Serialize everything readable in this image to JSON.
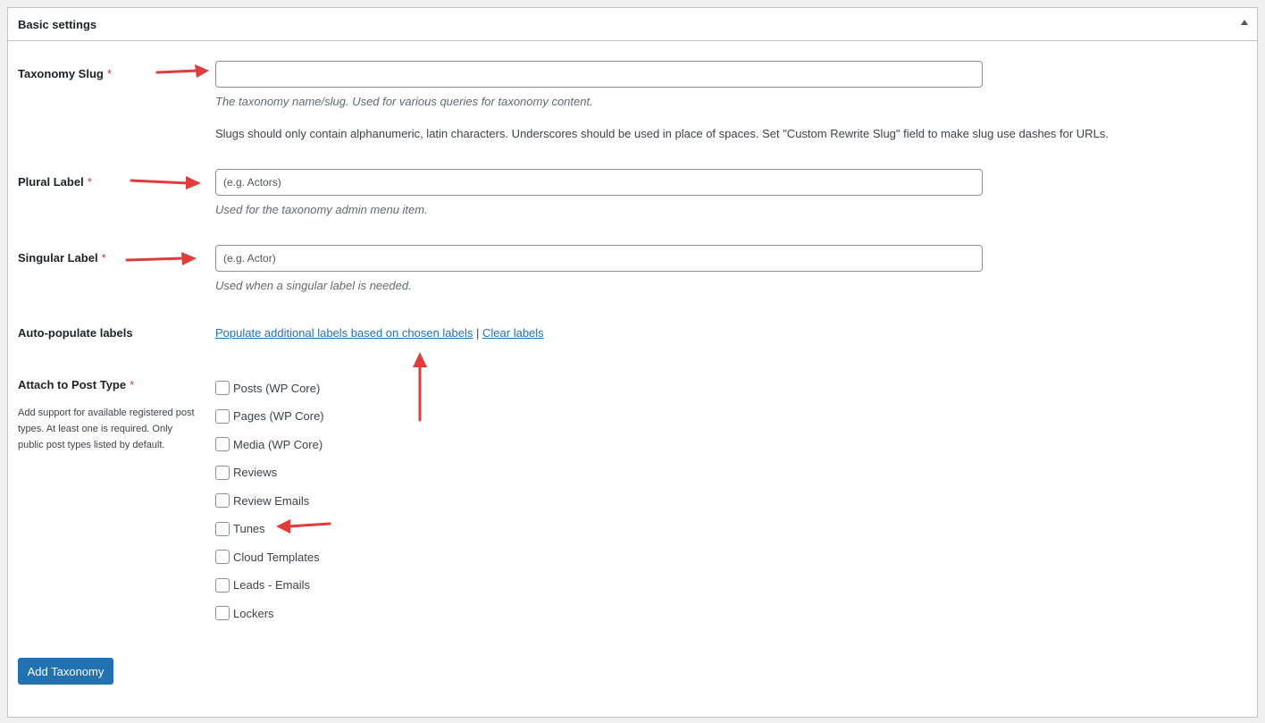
{
  "panel": {
    "title": "Basic settings",
    "toggle_icon": "triangle-up-icon"
  },
  "fields": {
    "slug": {
      "label": "Taxonomy Slug",
      "required": "*",
      "value": "",
      "placeholder": "",
      "description": "The taxonomy name/slug. Used for various queries for taxonomy content.",
      "note": "Slugs should only contain alphanumeric, latin characters. Underscores should be used in place of spaces. Set \"Custom Rewrite Slug\" field to make slug use dashes for URLs."
    },
    "plural": {
      "label": "Plural Label",
      "required": "*",
      "value": "",
      "placeholder": "(e.g. Actors)",
      "description": "Used for the taxonomy admin menu item."
    },
    "singular": {
      "label": "Singular Label",
      "required": "*",
      "value": "",
      "placeholder": "(e.g. Actor)",
      "description": "Used when a singular label is needed."
    },
    "autopopulate": {
      "label": "Auto-populate labels",
      "populate_link": "Populate additional labels based on chosen labels",
      "separator": "|",
      "clear_link": "Clear labels"
    },
    "attach": {
      "label": "Attach to Post Type",
      "required": "*",
      "description": "Add support for available registered post types. At least one is required. Only public post types listed by default.",
      "post_types": [
        {
          "label": "Posts (WP Core)",
          "checked": false
        },
        {
          "label": "Pages (WP Core)",
          "checked": false
        },
        {
          "label": "Media (WP Core)",
          "checked": false
        },
        {
          "label": "Reviews",
          "checked": false
        },
        {
          "label": "Review Emails",
          "checked": false
        },
        {
          "label": "Tunes",
          "checked": false
        },
        {
          "label": "Cloud Templates",
          "checked": false
        },
        {
          "label": "Leads - Emails",
          "checked": false
        },
        {
          "label": "Lockers",
          "checked": false
        }
      ]
    }
  },
  "submit": {
    "label": "Add Taxonomy"
  },
  "colors": {
    "accent": "#2271b1",
    "required": "#d63638",
    "annotation_arrow": "#e03c3c"
  }
}
